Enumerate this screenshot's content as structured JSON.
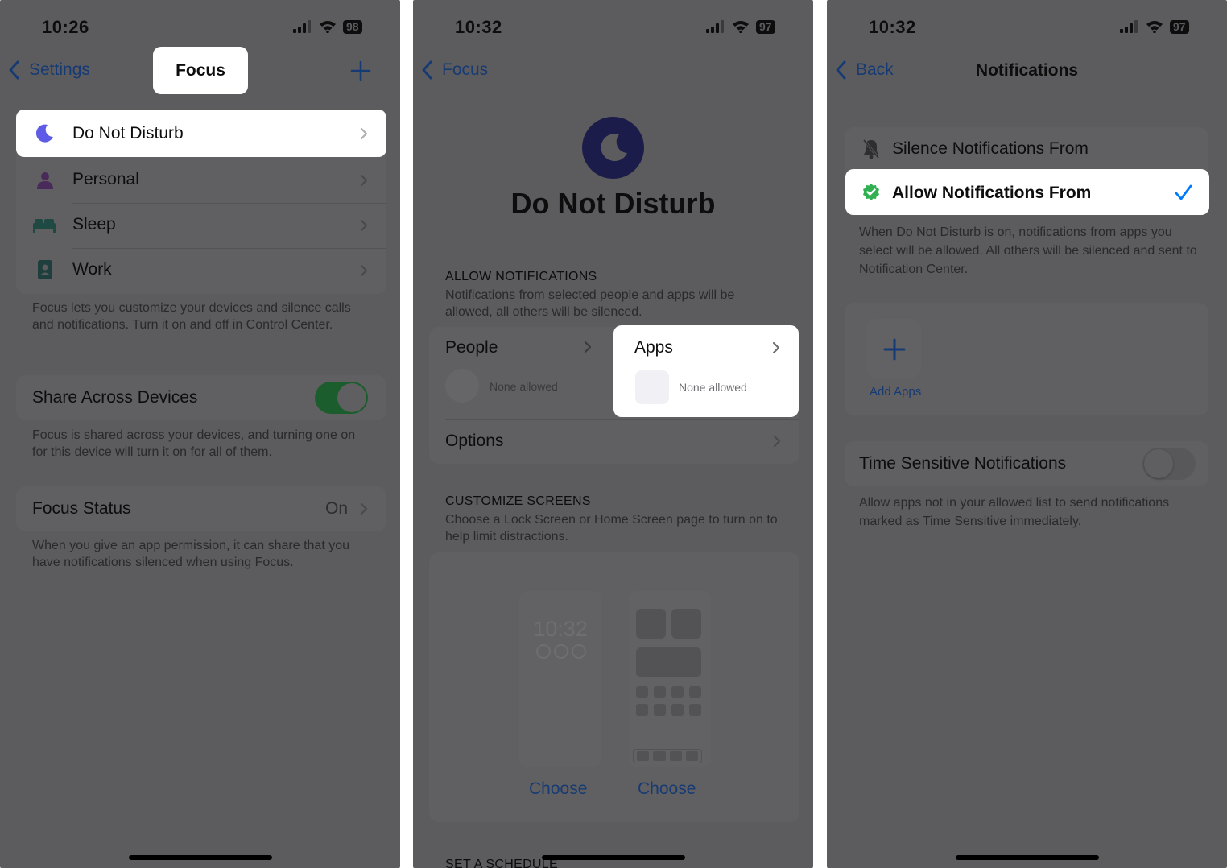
{
  "panel1": {
    "time": "10:26",
    "battery": "98",
    "back_label": "Settings",
    "title": "Focus",
    "items": [
      {
        "label": "Do Not Disturb"
      },
      {
        "label": "Personal"
      },
      {
        "label": "Sleep"
      },
      {
        "label": "Work"
      }
    ],
    "focus_footer": "Focus lets you customize your devices and silence calls and notifications. Turn it on and off in Control Center.",
    "share_label": "Share Across Devices",
    "share_on": true,
    "share_footer": "Focus is shared across your devices, and turning one on for this device will turn it on for all of them.",
    "status_label": "Focus Status",
    "status_value": "On",
    "status_footer": "When you give an app permission, it can share that you have notifications silenced when using Focus."
  },
  "panel2": {
    "time": "10:32",
    "battery": "97",
    "back_label": "Focus",
    "title": "Do Not Disturb",
    "allow_header": "ALLOW NOTIFICATIONS",
    "allow_desc": "Notifications from selected people and apps will be allowed, all others will be silenced.",
    "people_label": "People",
    "people_value": "None allowed",
    "apps_label": "Apps",
    "apps_value": "None allowed",
    "options_label": "Options",
    "customize_header": "CUSTOMIZE SCREENS",
    "customize_desc": "Choose a Lock Screen or Home Screen page to turn on to help limit distractions.",
    "lock_time": "10:32",
    "choose_lock": "Choose",
    "choose_home": "Choose",
    "schedule_header": "SET A SCHEDULE"
  },
  "panel3": {
    "time": "10:32",
    "battery": "97",
    "back_label": "Back",
    "title": "Notifications",
    "silence_label": "Silence Notifications From",
    "allow_label": "Allow Notifications From",
    "allow_desc": "When Do Not Disturb is on, notifications from apps you select will be allowed. All others will be silenced and sent to Notification Center.",
    "add_apps_label": "Add Apps",
    "time_sensitive_label": "Time Sensitive Notifications",
    "time_sensitive_on": false,
    "time_sensitive_desc": "Allow apps not in your allowed list to send notifications marked as Time Sensitive immediately."
  },
  "colors": {
    "accent_blue": "#163a74",
    "check_blue": "#007aff",
    "toggle_green": "#1b5d2c",
    "moon_purple": "#5e5ce6"
  }
}
